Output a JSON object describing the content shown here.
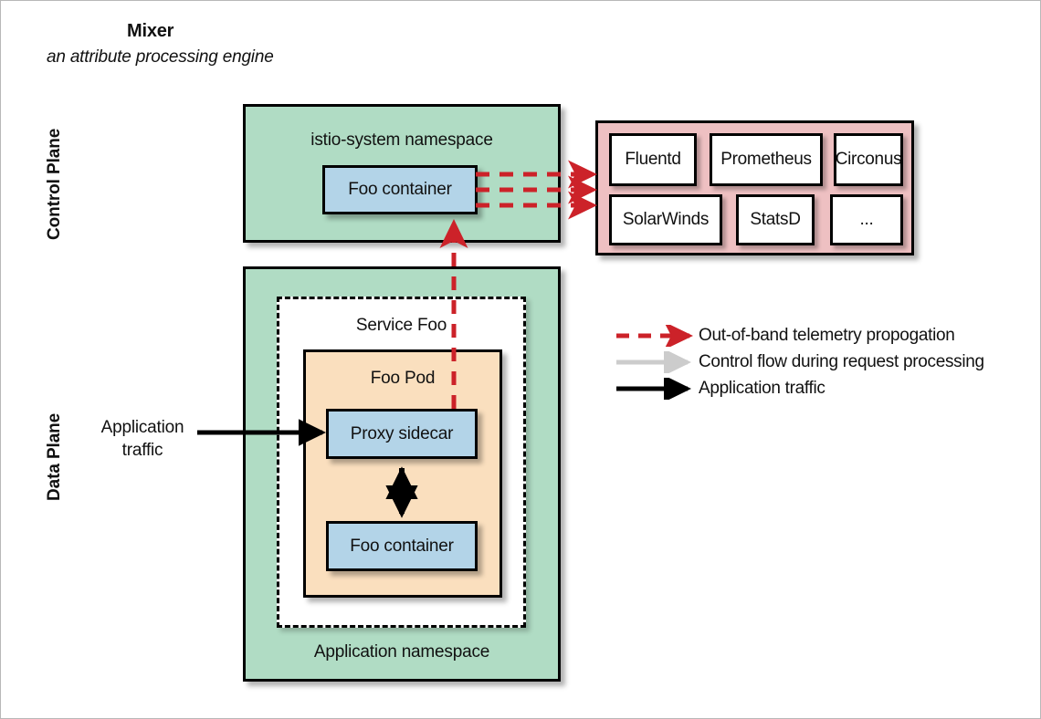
{
  "figure": {
    "title": "Mixer",
    "subtitle": "an attribute processing engine"
  },
  "planes": {
    "control": "Control Plane",
    "data": "Data Plane"
  },
  "control_plane": {
    "namespace_label": "istio-system namespace",
    "container_label": "Foo container"
  },
  "backends": {
    "items": [
      {
        "label": "Fluentd"
      },
      {
        "label": "Prometheus"
      },
      {
        "label": "Circonus"
      },
      {
        "label": "SolarWinds"
      },
      {
        "label": "StatsD"
      },
      {
        "label": "..."
      }
    ]
  },
  "data_plane": {
    "namespace_label": "Application namespace",
    "service_label": "Service Foo",
    "pod_label": "Foo Pod",
    "proxy_label": "Proxy sidecar",
    "container_label": "Foo container",
    "ingress_caption_line1": "Application",
    "ingress_caption_line2": "traffic"
  },
  "legend": {
    "items": [
      {
        "style": "dashed-red-arrow",
        "label": "Out-of-band telemetry propogation"
      },
      {
        "style": "solid-gray-arrow",
        "label": "Control flow during request processing"
      },
      {
        "style": "solid-black-arrow",
        "label": "Application traffic"
      }
    ]
  },
  "colors": {
    "namespace_green": "#b0dcc4",
    "container_blue": "#b3d4e8",
    "pod_orange": "#fadfbe",
    "backends_pink": "#eec0c2",
    "telemetry_red": "#cc2229",
    "control_flow_gray": "#cccccc",
    "app_traffic_black": "#000000",
    "frame_border": "#b8b8b8"
  }
}
